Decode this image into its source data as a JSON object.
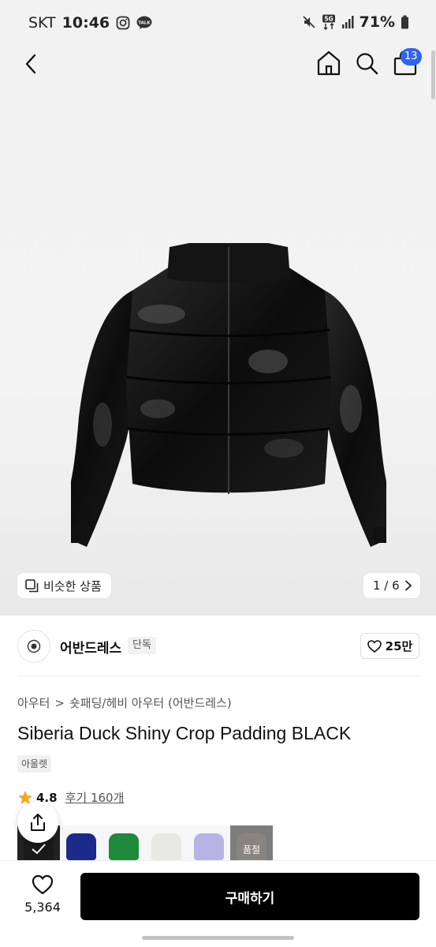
{
  "status_bar": {
    "carrier": "SKT",
    "time": "10:46",
    "network": "5G",
    "battery": "71%",
    "icons": [
      "instagram-icon",
      "talk-icon",
      "mute-icon",
      "signal-icon",
      "battery-icon"
    ]
  },
  "nav": {
    "icons": [
      "back-icon",
      "home-icon",
      "search-icon",
      "bag-icon"
    ],
    "cart_count": "13"
  },
  "gallery": {
    "similar_label": "비슷한 상품",
    "counter": "1 / 6"
  },
  "brand": {
    "name": "어반드레스",
    "tag": "단독",
    "likes": "25만"
  },
  "breadcrumb": {
    "category": "아우터",
    "separator": ">",
    "subcategory": "숏패딩/헤비 아우터 (어반드레스)"
  },
  "product": {
    "title": "Siberia Duck Shiny Crop Padding BLACK",
    "tag": "아울렛",
    "rating": "4.8",
    "rating_max": 5,
    "reviews": "후기 160개"
  },
  "colors": {
    "accent": "#2f63f0",
    "star": "#f5a623",
    "swatches": [
      {
        "color": "#1a1a1a",
        "state": "selected"
      },
      {
        "color": "#1c2a8a",
        "state": "available"
      },
      {
        "color": "#1f8a3a",
        "state": "available"
      },
      {
        "color": "#e8e8e4",
        "state": "available"
      },
      {
        "color": "#b9b2e4",
        "state": "available"
      },
      {
        "color": "#8a8480",
        "state": "soldout"
      }
    ],
    "soldout_label": "품절"
  },
  "bottom": {
    "wish_count": "5,364",
    "buy_label": "구매하기"
  }
}
